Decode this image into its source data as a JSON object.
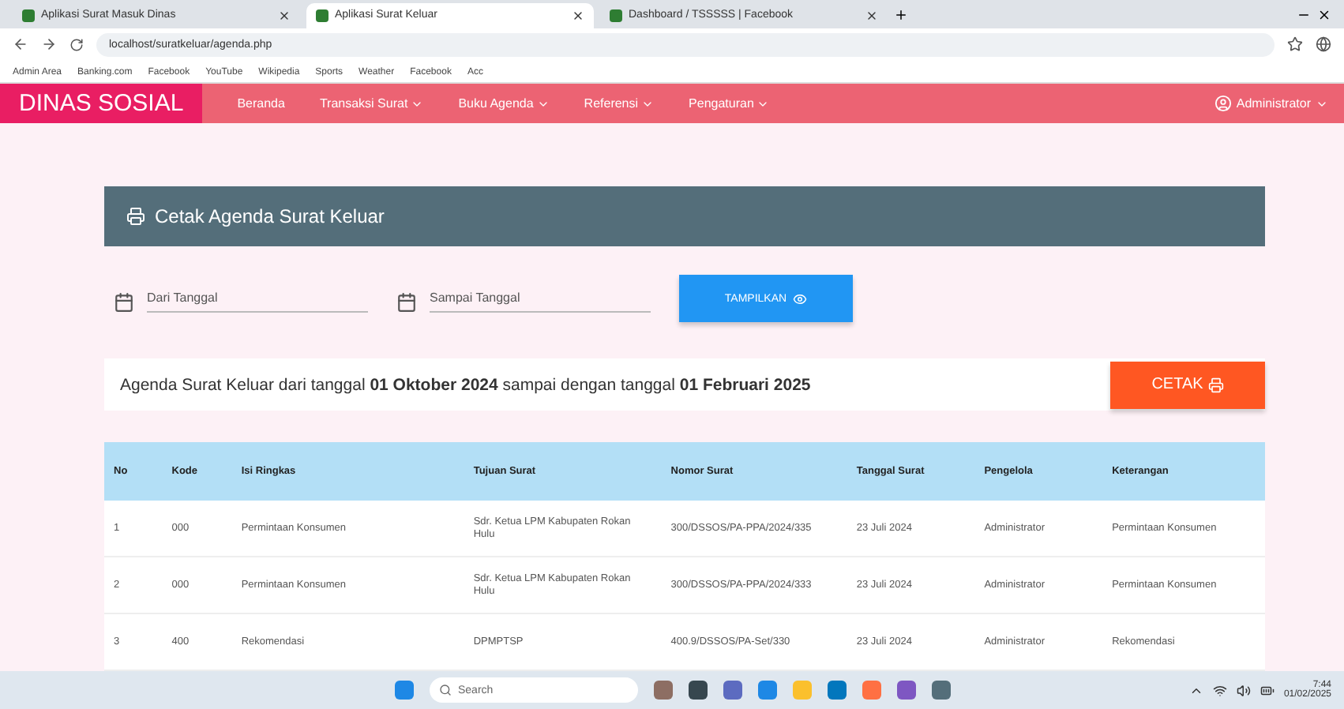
{
  "browser": {
    "tabs": [
      {
        "title": "Aplikasi Surat Masuk Dinas",
        "selected": false
      },
      {
        "title": "Aplikasi Surat Keluar",
        "selected": true
      },
      {
        "title": "Dashboard / TSSSSS | Facebook",
        "selected": false
      }
    ],
    "url": "localhost/suratkeluar/agenda.php",
    "bookmarks": [
      "Admin Area",
      "Banking.com",
      "Facebook",
      "YouTube",
      "Wikipedia",
      "Sports",
      "Weather",
      "Facebook",
      "Acc"
    ]
  },
  "navbar": {
    "brand": "DINAS SOSIAL",
    "menu": [
      {
        "label": "Beranda",
        "dropdown": false
      },
      {
        "label": "Transaksi Surat",
        "dropdown": true
      },
      {
        "label": "Buku Agenda",
        "dropdown": true
      },
      {
        "label": "Referensi",
        "dropdown": true
      },
      {
        "label": "Pengaturan",
        "dropdown": true
      }
    ],
    "user": "Administrator"
  },
  "card": {
    "title": "Cetak Agenda Surat Keluar"
  },
  "filters": [
    {
      "placeholder": "Dari Tanggal"
    },
    {
      "placeholder": "Sampai Tanggal"
    }
  ],
  "show_button": "TAMPILKAN",
  "summary": "Agenda Surat Keluar dari tanggal **01 Oktober 2024** sampai dengan tanggal **01 Februari 2025**",
  "print_button": "CETAK",
  "table": {
    "columns": [
      "No",
      "Kode",
      "Isi Ringkas",
      "Tujuan Surat",
      "Nomor Surat",
      "Tanggal Surat",
      "Pengelola",
      "Keterangan"
    ],
    "rows": [
      [
        "1",
        "000",
        "Permintaan Konsumen",
        "Sdr. Ketua LPM Kabupaten Rokan Hulu",
        "300/DSSOS/PA-PPA/2024/335",
        "23 Juli 2024",
        "Administrator",
        "Permintaan Konsumen"
      ],
      [
        "2",
        "000",
        "Permintaan Konsumen",
        "Sdr. Ketua LPM Kabupaten Rokan Hulu",
        "300/DSSOS/PA-PPA/2024/333",
        "23 Juli 2024",
        "Administrator",
        "Permintaan Konsumen"
      ],
      [
        "3",
        "400",
        "Rekomendasi",
        "DPMPTSP",
        "400.9/DSSOS/PA-Set/330",
        "23 Juli 2024",
        "Administrator",
        "Rekomendasi"
      ]
    ]
  },
  "taskbar": {
    "search": "Search",
    "time": "7:44",
    "date": "01/02/2025"
  }
}
